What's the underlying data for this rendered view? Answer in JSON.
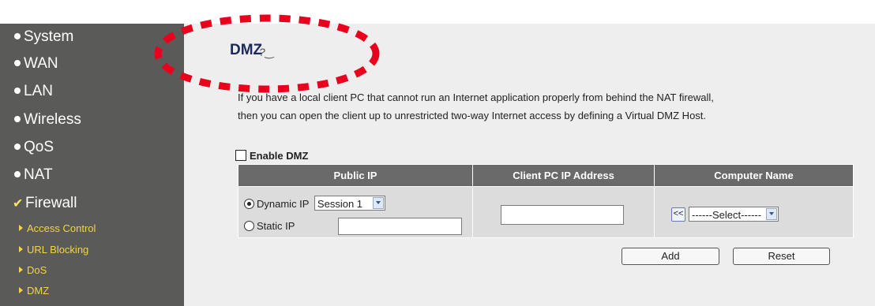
{
  "sidebar": {
    "items": [
      {
        "label": "System"
      },
      {
        "label": "WAN"
      },
      {
        "label": "LAN"
      },
      {
        "label": "Wireless"
      },
      {
        "label": "QoS"
      },
      {
        "label": "NAT"
      },
      {
        "label": "Firewall"
      }
    ],
    "firewall_sub": [
      {
        "label": "Access Control"
      },
      {
        "label": "URL Blocking"
      },
      {
        "label": "DoS"
      },
      {
        "label": "DMZ"
      }
    ]
  },
  "main": {
    "title": "DMZ",
    "description_line1": "If you have a local client PC that cannot run an Internet application properly from behind the NAT firewall,",
    "description_line2": "then you can open the client up to unrestricted two-way Internet access by defining a Virtual DMZ Host.",
    "enable_label": "Enable DMZ",
    "enable_checked": false
  },
  "table": {
    "headers": [
      "Public IP",
      "Client PC IP Address",
      "Computer Name"
    ],
    "dynamic_ip_label": "Dynamic IP",
    "dynamic_ip_selected": true,
    "session_value": "Session 1",
    "static_ip_label": "Static IP",
    "static_ip_value": "",
    "client_ip_value": "",
    "copy_button": "<<",
    "computer_select_value": "------Select------"
  },
  "buttons": {
    "add": "Add",
    "reset": "Reset"
  },
  "colors": {
    "sidebar_bg": "#5a5a58",
    "sub_item": "#f3d44a",
    "header_bg": "#6a6a6a",
    "highlight": "#e8001c"
  }
}
